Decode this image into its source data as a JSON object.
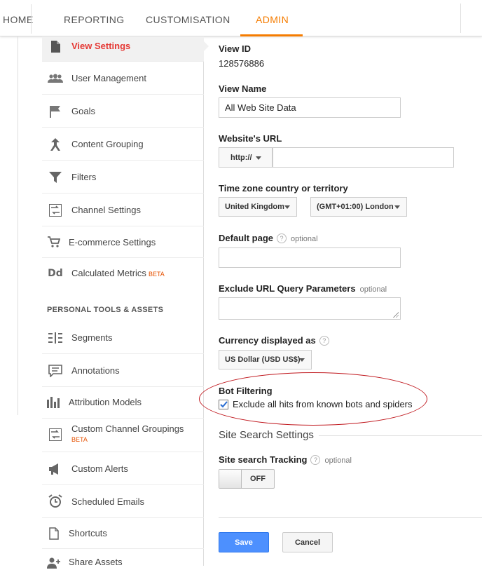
{
  "nav": {
    "home": "HOME",
    "reporting": "REPORTING",
    "customisation": "CUSTOMISATION",
    "admin": "ADMIN"
  },
  "sidebar": {
    "items": [
      {
        "label": "View Settings",
        "icon": "document-icon"
      },
      {
        "label": "User Management",
        "icon": "users-icon"
      },
      {
        "label": "Goals",
        "icon": "flag-icon"
      },
      {
        "label": "Content Grouping",
        "icon": "content-grouping-icon"
      },
      {
        "label": "Filters",
        "icon": "filter-icon"
      },
      {
        "label": "Channel Settings",
        "icon": "channel-settings-icon"
      },
      {
        "label": "E-commerce Settings",
        "icon": "cart-icon"
      },
      {
        "label": "Calculated Metrics",
        "icon": "dd-icon",
        "badge": "BETA"
      }
    ],
    "section_title": "PERSONAL TOOLS & ASSETS",
    "tools": [
      {
        "label": "Segments",
        "icon": "segments-icon"
      },
      {
        "label": "Annotations",
        "icon": "annotation-icon"
      },
      {
        "label": "Attribution Models",
        "icon": "bar-chart-icon"
      },
      {
        "label": "Custom Channel Groupings",
        "icon": "channel-groupings-icon",
        "badge": "BETA"
      },
      {
        "label": "Custom Alerts",
        "icon": "megaphone-icon"
      },
      {
        "label": "Scheduled Emails",
        "icon": "alarm-clock-icon"
      },
      {
        "label": "Shortcuts",
        "icon": "page-icon"
      },
      {
        "label": "Share Assets",
        "icon": "add-user-icon"
      }
    ]
  },
  "form": {
    "view_id_label": "View ID",
    "view_id_value": "128576886",
    "view_name_label": "View Name",
    "view_name_value": "All Web Site Data",
    "website_url_label": "Website's URL",
    "protocol_value": "http://",
    "website_url_value": "",
    "timezone_label": "Time zone country or territory",
    "country_value": "United Kingdom",
    "timezone_value": "(GMT+01:00) London",
    "default_page_label": "Default page",
    "default_page_value": "",
    "exclude_params_label": "Exclude URL Query Parameters",
    "exclude_params_value": "",
    "currency_label": "Currency displayed as",
    "currency_value": "US Dollar (USD US$)",
    "optional": "optional",
    "help": "?",
    "bot_filtering_label": "Bot Filtering",
    "bot_filtering_checkbox_label": "Exclude all hits from known bots and spiders",
    "bot_filtering_checked": true,
    "site_search_title": "Site Search Settings",
    "site_search_tracking_label": "Site search Tracking",
    "site_search_toggle_value": "OFF"
  },
  "buttons": {
    "save": "Save",
    "cancel": "Cancel"
  },
  "colors": {
    "accent": "#f57c00",
    "active_item": "#e53935",
    "primary_button": "#4d90fe",
    "annotation": "#c0181e"
  }
}
